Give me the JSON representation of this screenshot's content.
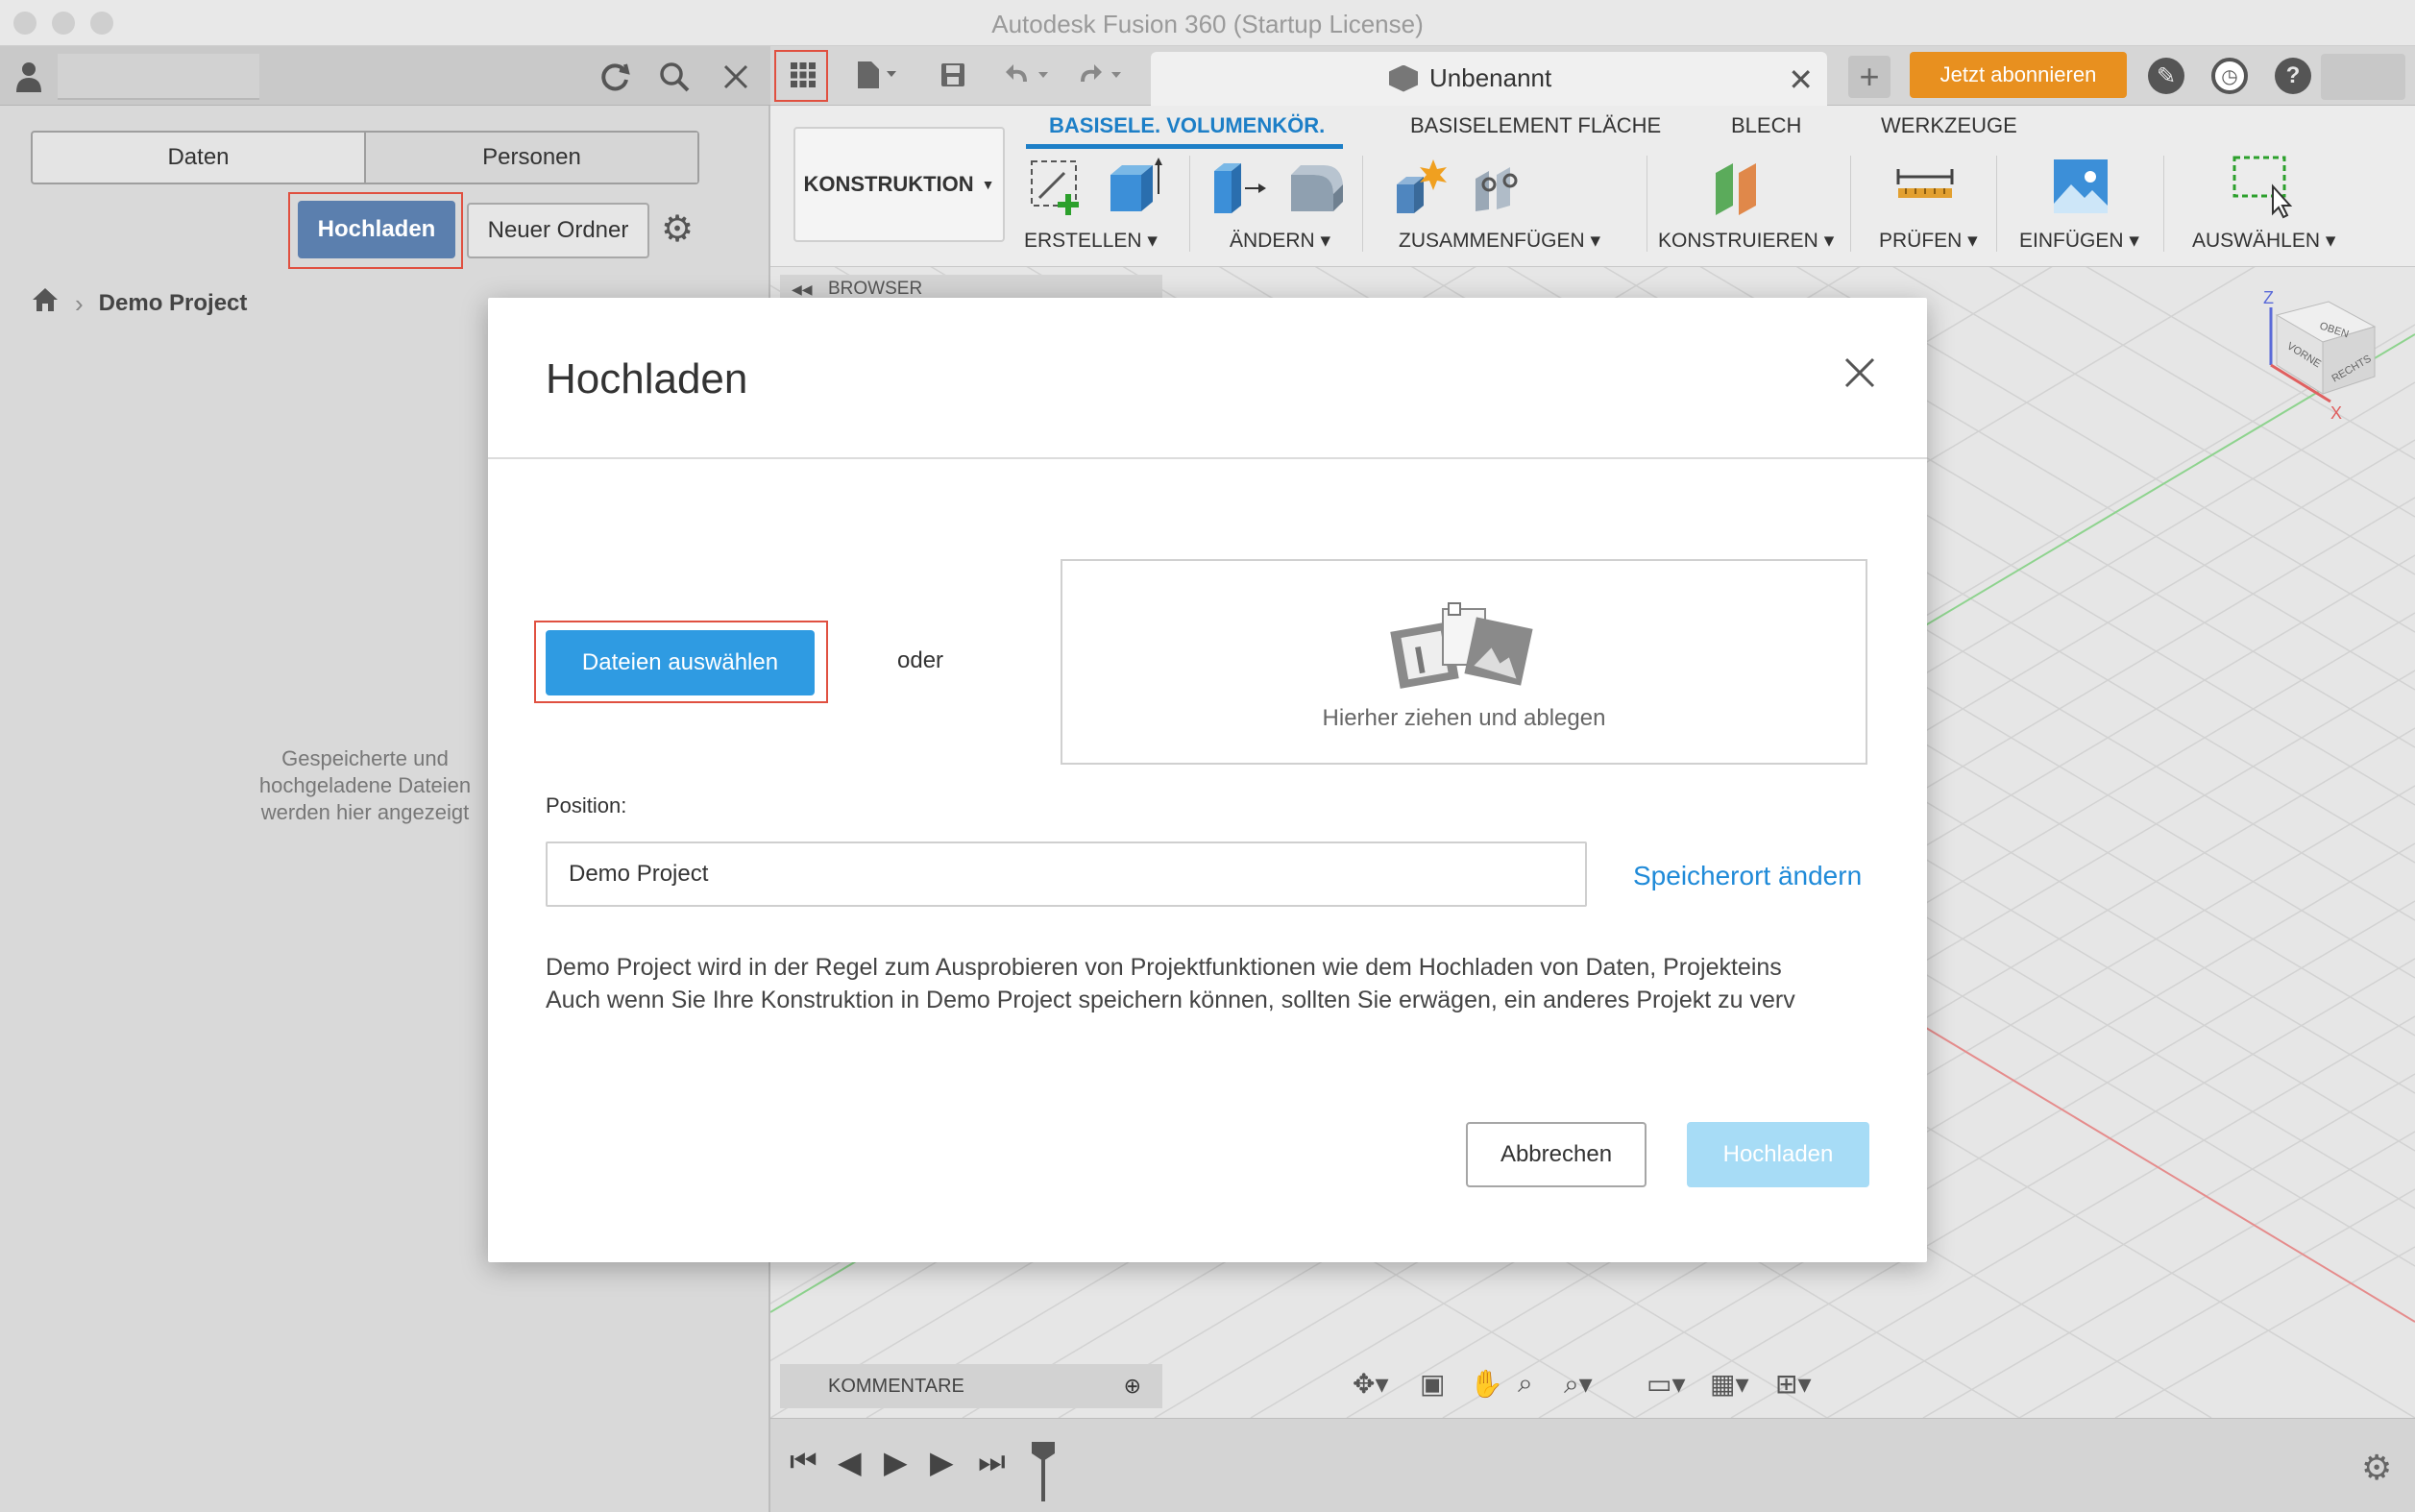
{
  "window": {
    "title": "Autodesk Fusion 360 (Startup License)"
  },
  "data_panel": {
    "tabs": [
      "Daten",
      "Personen"
    ],
    "upload_label": "Hochladen",
    "new_folder_label": "Neuer Ordner",
    "breadcrumb": "Demo Project",
    "empty_message": [
      "Gespeicherte und",
      "hochgeladene Dateien",
      "werden hier angezeigt"
    ]
  },
  "toolbar": {
    "document_name": "Unbenannt",
    "subscribe_label": "Jetzt abonnieren"
  },
  "ribbon": {
    "workspace": "KONSTRUKTION",
    "tabs": [
      "BASISELE. VOLUMENKÖR.",
      "BASISELEMENT FLÄCHE",
      "BLECH",
      "WERKZEUGE"
    ],
    "groups": [
      "ERSTELLEN",
      "ÄNDERN",
      "ZUSAMMENFÜGEN",
      "KONSTRUIEREN",
      "PRÜFEN",
      "EINFÜGEN",
      "AUSWÄHLEN"
    ]
  },
  "viewport": {
    "browser_label": "BROWSER",
    "comments_label": "KOMMENTARE"
  },
  "viewcube": {
    "top": "OBEN",
    "front": "VORNE",
    "right": "RECHTS",
    "axis_z": "Z",
    "axis_x": "X"
  },
  "dialog": {
    "title": "Hochladen",
    "choose_files_label": "Dateien auswählen",
    "or_label": "oder",
    "dropzone_label": "Hierher ziehen und ablegen",
    "position_label": "Position:",
    "position_value": "Demo Project",
    "change_location_label": "Speicherort ändern",
    "description_lines": [
      "Demo Project wird in der Regel zum Ausprobieren von Projektfunktionen wie dem Hochladen von Daten, Projekteins",
      "Auch wenn Sie Ihre Konstruktion in Demo Project speichern können, sollten Sie erwägen, ein anderes Projekt zu verv"
    ],
    "cancel_label": "Abbrechen",
    "upload_label": "Hochladen"
  },
  "colors": {
    "accent_blue": "#2f9be2",
    "link_blue": "#1f8ad8",
    "upload_disabled": "#a7dcf6",
    "subscribe_orange": "#e8901f",
    "highlight_red": "#e05040",
    "panel_upload_blue": "#5b7fae"
  }
}
